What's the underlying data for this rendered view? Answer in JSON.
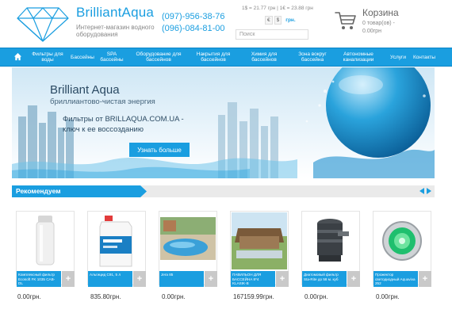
{
  "header": {
    "brand": "BrilliantAqua",
    "tagline": "Интернет-магазин водного оборудования",
    "phone1": "(097)-956-38-76",
    "phone2": "(096)-084-81-00",
    "rates": "1$ = 21.77 грн  |  1€ = 23.88 грн",
    "currencies": [
      "€",
      "$",
      "грн."
    ],
    "search_placeholder": "Поиск",
    "cart_title": "Корзина",
    "cart_items": "0 товар(ов) -",
    "cart_total": "0.00грн"
  },
  "nav": {
    "items": [
      "Фильтры для воды",
      "Бассейны",
      "SPA бассейны",
      "Оборудование для бассейнов",
      "Накрытия для бассейнов",
      "Химия для бассейнов",
      "Зона вокруг бассейна",
      "Автономные канализации",
      "Услуги",
      "Контакты"
    ]
  },
  "banner": {
    "title": "Brilliant Aqua",
    "subtitle": "бриллиантово-чистая энергия",
    "line1": "Фильтры от BRILLAQUA.COM.UA -",
    "line2": "ключ к ее воссозданию",
    "button": "Узнать больше"
  },
  "recommended": {
    "title": "Рекомендуем",
    "products": [
      {
        "name": "Комплексный фильтр Ecosoft FK 1035 CAB-DL",
        "price": "0.00грн."
      },
      {
        "name": "Альгицид C91, 5 л",
        "price": "835.80грн."
      },
      {
        "name": "Jera 85",
        "price": "0.00грн."
      },
      {
        "name": "ПАВИЛЬОН ДЛЯ БАССЕЙНА 8*4 KLASIK-B",
        "price": "167159.99грн."
      },
      {
        "name": "Диатомовый фильтр Sta-Rite до 58 м. куб",
        "price": "0.00грн."
      },
      {
        "name": "Прожектор светодиодный Aquaviva 252",
        "price": "0.00грн."
      }
    ]
  },
  "colors": {
    "accent": "#1a9ee0",
    "plus": "#c9c9c9"
  },
  "icons": [
    "diamond-logo-icon",
    "home-icon",
    "cart-icon",
    "arrow-left-icon",
    "arrow-right-icon",
    "plus-icon"
  ]
}
